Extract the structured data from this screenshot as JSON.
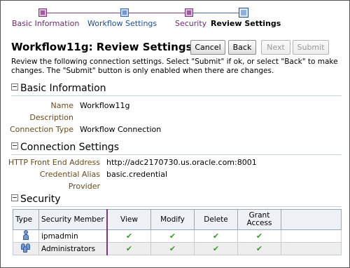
{
  "train": {
    "steps": [
      {
        "label": "Basic Information",
        "state": "visited"
      },
      {
        "label": "Workflow Settings",
        "state": "plain"
      },
      {
        "label": "Security",
        "state": "visited"
      },
      {
        "label": "Review Settings",
        "state": "current"
      }
    ]
  },
  "header": {
    "title": "Workflow11g: Review Settings",
    "buttons": {
      "cancel": "Cancel",
      "back": "Back",
      "next": "Next",
      "submit": "Submit"
    },
    "instructions": "Review the following connection settings. Select \"Submit\" if ok, or select \"Back\" to make changes. The \"Submit\" button is only enabled when there are changes."
  },
  "basic_information": {
    "heading": "Basic Information",
    "fields": [
      {
        "label": "Name",
        "value": "Workflow11g"
      },
      {
        "label": "Description",
        "value": ""
      },
      {
        "label": "Connection Type",
        "value": "Workflow Connection"
      }
    ]
  },
  "connection_settings": {
    "heading": "Connection Settings",
    "fields": [
      {
        "label": "HTTP Front End Address",
        "value": "http://adc2170730.us.oracle.com:8001"
      },
      {
        "label": "Credential Alias",
        "value": "basic.credential"
      },
      {
        "label": "Provider",
        "value": ""
      }
    ]
  },
  "security": {
    "heading": "Security",
    "columns": [
      "Type",
      "Security Member",
      "View",
      "Modify",
      "Delete",
      "Grant Access"
    ],
    "rows": [
      {
        "type_icon": "user-icon",
        "member": "ipmadmin",
        "view": "✔",
        "modify": "✔",
        "delete": "✔",
        "grant": "✔"
      },
      {
        "type_icon": "group-icon",
        "member": "Administrators",
        "view": "✔",
        "modify": "✔",
        "delete": "✔",
        "grant": "✔"
      }
    ]
  }
}
